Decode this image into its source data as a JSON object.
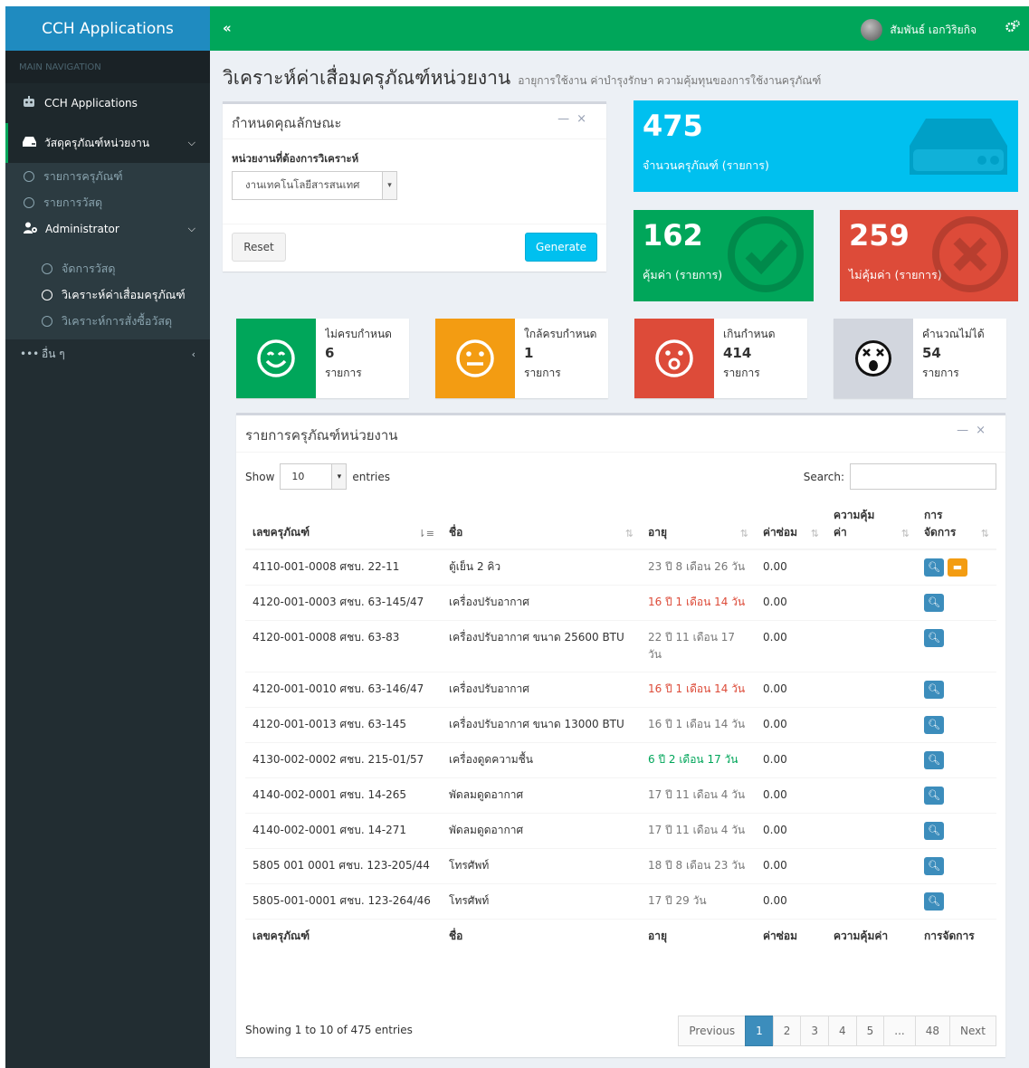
{
  "app": {
    "logo": "CCH Applications"
  },
  "sidebar": {
    "header": "MAIN NAVIGATION",
    "app_item": "CCH Applications",
    "menu_item": "วัสดุครุภัณฑ์หน่วยงาน",
    "sub_items": [
      "รายการครุภัณฑ์",
      "รายการวัสดุ"
    ],
    "admin_label": "Administrator",
    "admin_items": [
      "จัดการวัสดุ",
      "วิเคราะห์ค่าเสื่อมครุภัณฑ์",
      "วิเคราะห์การสั่งซื้อวัสดุ"
    ],
    "other": "อื่น ๆ"
  },
  "header": {
    "user_name": "สัมพันธ์ เอกวิริยกิจ"
  },
  "page": {
    "title": "วิเคราะห์ค่าเสื่อมครุภัณฑ์หน่วยงาน",
    "subtitle": "อายุการใช้งาน ค่าบำรุงรักษา ความคุ้มทุนของการใช้งานครุภัณฑ์"
  },
  "filter": {
    "title": "กำหนดคุณลักษณะ",
    "label": "หน่วยงานที่ต้องการวิเคราะห์",
    "selected": "งานเทคโนโลยีสารสนเทศ",
    "reset": "Reset",
    "generate": "Generate"
  },
  "stats": {
    "total_num": "475",
    "total_text": "จำนวนครุภัณฑ์ (รายการ)",
    "worth_num": "162",
    "worth_text": "คุ้มค่า (รายการ)",
    "notworth_num": "259",
    "notworth_text": "ไม่คุ้มค่า (รายการ)"
  },
  "infoboxes": [
    {
      "label": "ไม่ครบกำหนด",
      "num": "6",
      "unit": "รายการ"
    },
    {
      "label": "ใกล้ครบกำหนด",
      "num": "1",
      "unit": "รายการ"
    },
    {
      "label": "เกินกำหนด",
      "num": "414",
      "unit": "รายการ"
    },
    {
      "label": "คำนวณไม่ได้",
      "num": "54",
      "unit": "รายการ"
    }
  ],
  "table": {
    "title": "รายการครุภัณฑ์หน่วยงาน",
    "show": "Show",
    "length": "10",
    "entries": "entries",
    "search": "Search:",
    "headers": [
      "เลขครุภัณฑ์",
      "ชื่อ",
      "อายุ",
      "ค่าซ่อม",
      "ความคุ้มค่า",
      "การจัดการ"
    ],
    "rows": [
      {
        "id": "4110-001-0008 ศชบ. 22-11",
        "name": "ตู้เย็น 2 คิว",
        "age": "23 ปี 8 เดือน 26 วัน",
        "cost": "0.00",
        "worth": ""
      },
      {
        "id": "4120-001-0003 ศชบ. 63-145/47",
        "name": "เครื่องปรับอากาศ",
        "age": "16 ปี 1 เดือน 14 วัน",
        "cost": "0.00",
        "worth": ""
      },
      {
        "id": "4120-001-0008 ศชบ. 63-83",
        "name": "เครื่องปรับอากาศ ขนาด 25600 BTU",
        "age": "22 ปี 11 เดือน 17 วัน",
        "cost": "0.00",
        "worth": ""
      },
      {
        "id": "4120-001-0010 ศชบ. 63-146/47",
        "name": "เครื่องปรับอากาศ",
        "age": "16 ปี 1 เดือน 14 วัน",
        "cost": "0.00",
        "worth": ""
      },
      {
        "id": "4120-001-0013 ศชบ. 63-145",
        "name": "เครื่องปรับอากาศ ขนาด 13000 BTU",
        "age": "16 ปี 1 เดือน 14 วัน",
        "cost": "0.00",
        "worth": ""
      },
      {
        "id": "4130-002-0002 ศชบ. 215-01/57",
        "name": "เครื่องดูดความชื้น",
        "age": "6 ปี 2 เดือน 17 วัน",
        "cost": "0.00",
        "worth": ""
      },
      {
        "id": "4140-002-0001 ศชบ. 14-265",
        "name": "พัดลมดูดอากาศ",
        "age": "17 ปี 11 เดือน 4 วัน",
        "cost": "0.00",
        "worth": ""
      },
      {
        "id": "4140-002-0001 ศชบ. 14-271",
        "name": "พัดลมดูดอากาศ",
        "age": "17 ปี 11 เดือน 4 วัน",
        "cost": "0.00",
        "worth": ""
      },
      {
        "id": "5805 001 0001 ศชบ. 123-205/44",
        "name": "โทรศัพท์",
        "age": "18 ปี 8 เดือน 23 วัน",
        "cost": "0.00",
        "worth": ""
      },
      {
        "id": "5805-001-0001 ศชบ. 123-264/46",
        "name": "โทรศัพท์",
        "age": "17 ปี 29 วัน",
        "cost": "0.00",
        "worth": ""
      }
    ],
    "info": "Showing 1 to 10 of 475 entries",
    "pages": [
      "Previous",
      "1",
      "2",
      "3",
      "4",
      "5",
      "...",
      "48",
      "Next"
    ]
  },
  "colors": {
    "green": "#00a65a",
    "aqua": "#00c0ef",
    "red": "#dd4b39",
    "yellow": "#f39c12",
    "sidebar": "#222d32",
    "logo": "#1f8bc0"
  }
}
